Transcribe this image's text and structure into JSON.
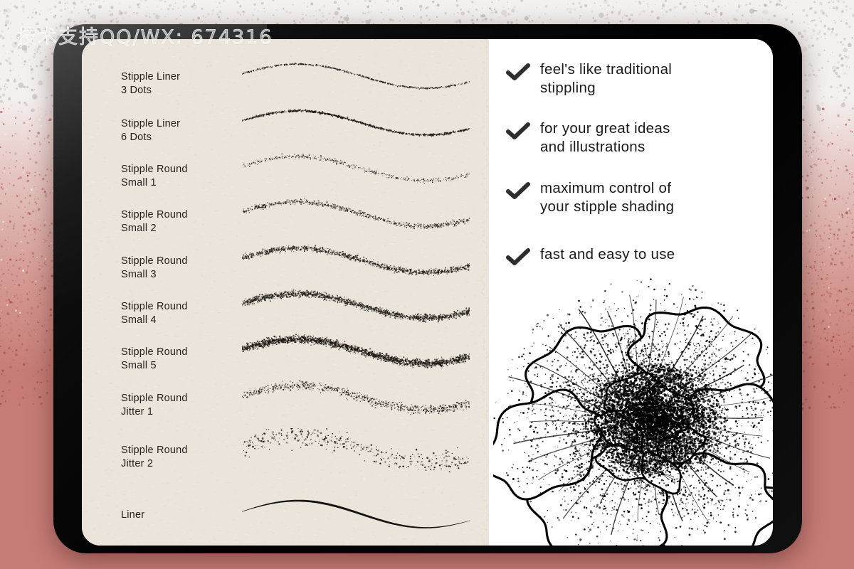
{
  "watermark": {
    "text": "技术支持QQ/WX: 674316"
  },
  "device": {
    "name": "tablet",
    "bezel_color": "#000000",
    "screen_bg": "#ffffff"
  },
  "colors": {
    "paper": "#eae4da",
    "ink": "#241f1b",
    "rose_background": "#c67c76",
    "top_background": "#f2f1ef",
    "check_mark": "#2e2e2e",
    "feature_text": "#1b1b1b"
  },
  "left_panel": {
    "name": "brush-list",
    "brushes": [
      {
        "label": "Stipple Liner\n3 Dots",
        "stroke": "sparse-dotted-wave",
        "density": 0.22,
        "dot_size": 0.9,
        "band": 3,
        "amp": 17
      },
      {
        "label": "Stipple Liner\n6 Dots",
        "stroke": "dotted-wave",
        "density": 0.4,
        "dot_size": 1.0,
        "band": 4,
        "amp": 17
      },
      {
        "label": "Stipple Round\nSmall 1",
        "stroke": "light-stipple-wave",
        "density": 0.18,
        "dot_size": 0.8,
        "band": 9,
        "amp": 17
      },
      {
        "label": "Stipple Round\nSmall 2",
        "stroke": "stipple-wave",
        "density": 0.3,
        "dot_size": 0.9,
        "band": 10,
        "amp": 17
      },
      {
        "label": "Stipple Round\nSmall 3",
        "stroke": "medium-stipple-wave",
        "density": 0.48,
        "dot_size": 1.0,
        "band": 11,
        "amp": 17
      },
      {
        "label": "Stipple Round\nSmall 4",
        "stroke": "dense-stipple-wave",
        "density": 0.7,
        "dot_size": 1.0,
        "band": 12,
        "amp": 17
      },
      {
        "label": "Stipple Round\nSmall 5",
        "stroke": "heavy-stipple-wave",
        "density": 0.95,
        "dot_size": 1.1,
        "band": 14,
        "amp": 17
      },
      {
        "label": "Stipple Round\nJitter 1",
        "stroke": "jitter-stipple-wave",
        "density": 0.3,
        "dot_size": 1.0,
        "band": 16,
        "amp": 17
      },
      {
        "label": "Stipple Round\nJitter 2",
        "stroke": "scatter-stipple-wave",
        "density": 0.16,
        "dot_size": 1.2,
        "band": 30,
        "amp": 19
      },
      {
        "label": "Liner",
        "stroke": "solid-tapered-wave",
        "density": 1.0,
        "dot_size": 0,
        "band": 0,
        "amp": 19
      }
    ]
  },
  "right_panel": {
    "name": "feature-list",
    "check_icon": "check-icon",
    "features": [
      {
        "text": "feel's like traditional\nstippling"
      },
      {
        "text": "for your great ideas\nand illustrations"
      },
      {
        "text": "maximum control of\nyour stipple shading"
      },
      {
        "text": "fast and easy to use"
      }
    ],
    "illustration": {
      "name": "stippled-flower-illustration",
      "subject": "flower"
    }
  }
}
